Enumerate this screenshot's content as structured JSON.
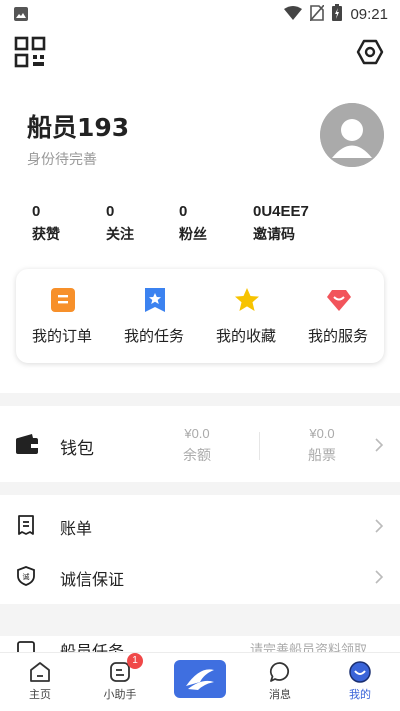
{
  "status_bar": {
    "time": "09:21",
    "icons": [
      "image-notification-icon",
      "wifi-icon",
      "no-sim-icon",
      "battery-charging-icon"
    ]
  },
  "header": {
    "icons": [
      "qr-code-icon",
      "settings-hexagon-icon"
    ]
  },
  "profile": {
    "name": "船员193",
    "subtitle": "身份待完善",
    "avatar_icon": "default-avatar-icon"
  },
  "stats": [
    {
      "value": "0",
      "label": "获赞"
    },
    {
      "value": "0",
      "label": "关注"
    },
    {
      "value": "0",
      "label": "粉丝"
    },
    {
      "value": "0U4EE7",
      "label": "邀请码"
    }
  ],
  "quick_actions": [
    {
      "label": "我的订单",
      "icon": "order-icon",
      "color": "#f7902a"
    },
    {
      "label": "我的任务",
      "icon": "task-icon",
      "color": "#3b82f0"
    },
    {
      "label": "我的收藏",
      "icon": "star-icon",
      "color": "#f7c300"
    },
    {
      "label": "我的服务",
      "icon": "service-gem-icon",
      "color": "#f2545b"
    }
  ],
  "wallet": {
    "label": "钱包",
    "balance_value": "¥0.0",
    "balance_label": "余额",
    "ticket_value": "¥0.0",
    "ticket_label": "船票"
  },
  "menu": [
    {
      "label": "账单",
      "icon": "bill-icon"
    },
    {
      "label": "诚信保证",
      "icon": "trust-shield-icon"
    }
  ],
  "partial_row": {
    "label": "船员任务",
    "hint": "请完善船员资料领取"
  },
  "bottom_nav": [
    {
      "label": "主页",
      "icon": "home-icon"
    },
    {
      "label": "小助手",
      "icon": "assistant-icon",
      "badge": "1"
    },
    {
      "label": "",
      "icon": "publish-icon"
    },
    {
      "label": "消息",
      "icon": "message-icon"
    },
    {
      "label": "我的",
      "icon": "profile-icon",
      "active": true
    }
  ],
  "colors": {
    "accent": "#3f6fe0",
    "badge": "#f04848"
  }
}
